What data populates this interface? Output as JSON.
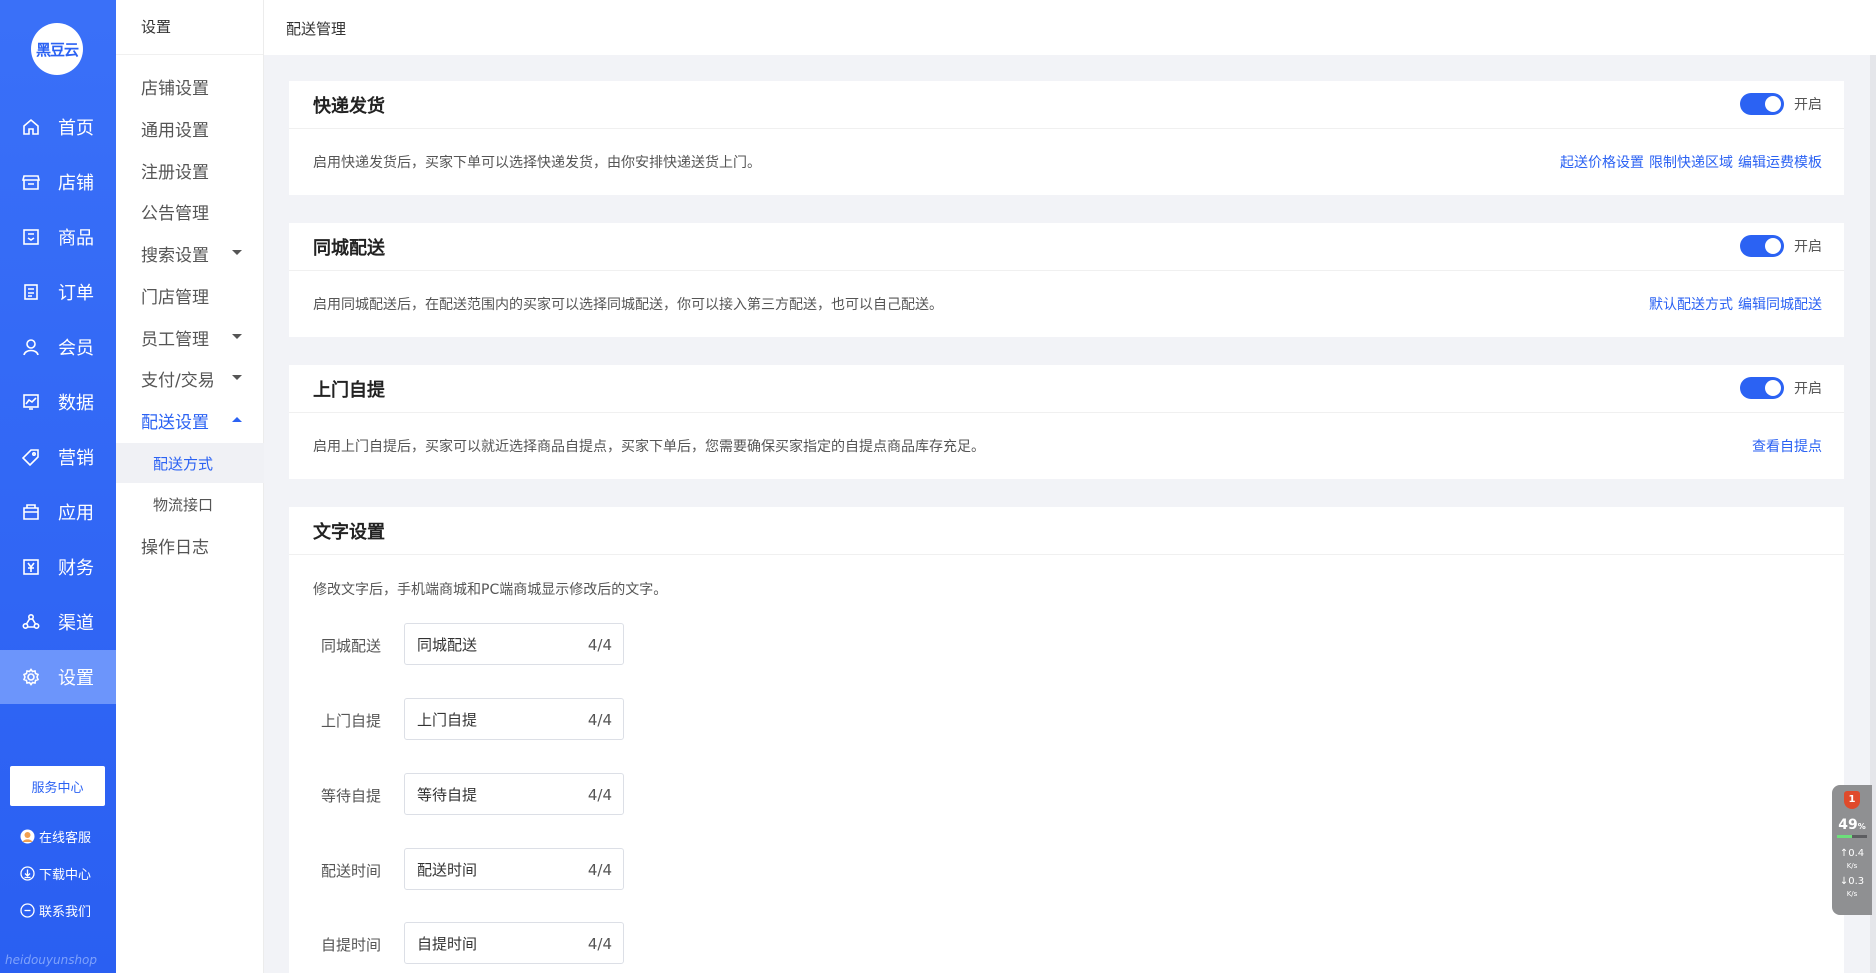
{
  "brand": {
    "logo_text": "黑豆云",
    "watermark": "heidouyunshop"
  },
  "nav": {
    "items": [
      {
        "label": "首页",
        "icon": "home-icon"
      },
      {
        "label": "店铺",
        "icon": "store-icon"
      },
      {
        "label": "商品",
        "icon": "goods-icon"
      },
      {
        "label": "订单",
        "icon": "order-icon"
      },
      {
        "label": "会员",
        "icon": "member-icon"
      },
      {
        "label": "数据",
        "icon": "chart-icon"
      },
      {
        "label": "营销",
        "icon": "tag-icon"
      },
      {
        "label": "应用",
        "icon": "app-icon"
      },
      {
        "label": "财务",
        "icon": "finance-icon"
      },
      {
        "label": "渠道",
        "icon": "channel-icon"
      },
      {
        "label": "设置",
        "icon": "gear-icon"
      }
    ],
    "active_index": 10,
    "service_center": "服务中心",
    "online_service": "在线客服",
    "download_center": "下载中心",
    "contact_us": "联系我们"
  },
  "subnav": {
    "title": "设置",
    "items": [
      {
        "label": "店铺设置"
      },
      {
        "label": "通用设置"
      },
      {
        "label": "注册设置"
      },
      {
        "label": "公告管理"
      },
      {
        "label": "搜索设置"
      },
      {
        "label": "门店管理"
      },
      {
        "label": "员工管理"
      },
      {
        "label": "支付/交易"
      },
      {
        "label": "配送设置"
      },
      {
        "label": "配送方式"
      },
      {
        "label": "物流接口"
      },
      {
        "label": "操作日志"
      }
    ]
  },
  "breadcrumb": "配送管理",
  "switch_label": "开启",
  "express": {
    "title": "快递发货",
    "desc": "启用快递发货后，买家下单可以选择快递发货，由你安排快递送货上门。",
    "links": [
      "起送价格设置",
      "限制快递区域",
      "编辑运费模板"
    ]
  },
  "local": {
    "title": "同城配送",
    "desc": "启用同城配送后，在配送范围内的买家可以选择同城配送，你可以接入第三方配送，也可以自己配送。",
    "links": [
      "默认配送方式",
      "编辑同城配送"
    ]
  },
  "pickup": {
    "title": "上门自提",
    "desc": "启用上门自提后，买家可以就近选择商品自提点，买家下单后，您需要确保买家指定的自提点商品库存充足。",
    "links": [
      "查看自提点"
    ]
  },
  "text_settings": {
    "title": "文字设置",
    "desc": "修改文字后，手机端商城和PC端商城显示修改后的文字。",
    "fields": [
      {
        "label": "同城配送",
        "value": "同城配送",
        "count": "4/4"
      },
      {
        "label": "上门自提",
        "value": "上门自提",
        "count": "4/4"
      },
      {
        "label": "等待自提",
        "value": "等待自提",
        "count": "4/4"
      },
      {
        "label": "配送时间",
        "value": "配送时间",
        "count": "4/4"
      },
      {
        "label": "自提时间",
        "value": "自提时间",
        "count": "4/4"
      }
    ]
  },
  "widget": {
    "badge": "1",
    "percent": "49",
    "percent_unit": "%",
    "up": "0.4",
    "down": "0.3",
    "unit": "K/s"
  },
  "colors": {
    "primary": "#2b62f3",
    "active_nav": "#6c95fb"
  }
}
